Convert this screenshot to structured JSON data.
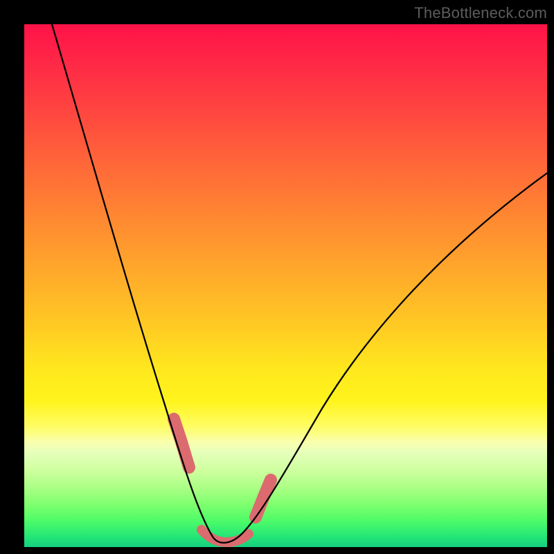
{
  "watermark": "TheBottleneck.com",
  "colors": {
    "frame": "#000000",
    "gradient_top": "#ff1248",
    "gradient_bottom": "#15cf80",
    "curve": "#000000",
    "marker": "#db6b6e",
    "watermark_text": "#5c5c5c"
  },
  "chart_data": {
    "type": "line",
    "title": "",
    "xlabel": "",
    "ylabel": "",
    "xlim": [
      0,
      100
    ],
    "ylim": [
      0,
      100
    ],
    "grid": false,
    "legend_position": "none",
    "series": [
      {
        "name": "bottleneck-curve",
        "x": [
          10,
          14,
          18,
          22,
          26,
          29,
          31,
          33,
          35,
          36,
          37,
          38,
          40,
          42,
          44,
          47,
          52,
          58,
          66,
          75,
          85,
          95,
          100
        ],
        "values": [
          100,
          88,
          75,
          62,
          48,
          35,
          25,
          16,
          9,
          5,
          2,
          1,
          1,
          2,
          4,
          8,
          15,
          24,
          35,
          47,
          58,
          68,
          72
        ]
      }
    ],
    "markers": [
      {
        "name": "left-segment-marker",
        "x_range": [
          29,
          32
        ],
        "y_range": [
          12,
          24
        ]
      },
      {
        "name": "valley-marker",
        "x_range": [
          34,
          41
        ],
        "y_range": [
          0,
          3
        ]
      },
      {
        "name": "right-segment-marker",
        "x_range": [
          43,
          46
        ],
        "y_range": [
          6,
          12
        ]
      }
    ],
    "annotations": [
      {
        "text": "TheBottleneck.com",
        "position": "top-right"
      }
    ]
  }
}
